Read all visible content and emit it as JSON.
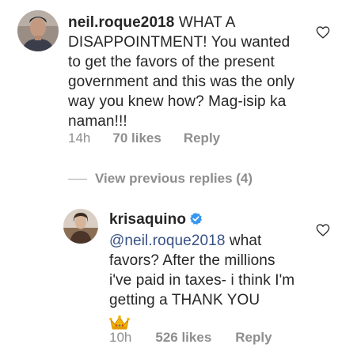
{
  "comment": {
    "username": "neil.roque2018",
    "text": "WHAT A DISAPPOINTMENT! You wanted to get the favors of the present government and this was the only way you knew how? Mag-isip ka naman!!!",
    "time": "14h",
    "likes": "70 likes",
    "reply_label": "Reply",
    "avatar_icon": "profile-photo-man",
    "like_icon": "heart-outline-icon"
  },
  "view_replies": {
    "label": "View previous replies (4)"
  },
  "reply": {
    "username": "krisaquino",
    "verified_icon": "verified-badge-icon",
    "mention": "@neil.roque2018",
    "text": " what favors? After the millions i've paid in taxes- i think I'm getting a THANK YOU",
    "emoji_icon": "crown-emoji",
    "time": "10h",
    "likes": "526 likes",
    "reply_label": "Reply",
    "avatar_icon": "profile-photo-woman",
    "like_icon": "heart-outline-icon"
  },
  "colors": {
    "text": "#262626",
    "secondary": "#8e8e8e",
    "mention": "#385185",
    "verified": "#3897f0"
  }
}
